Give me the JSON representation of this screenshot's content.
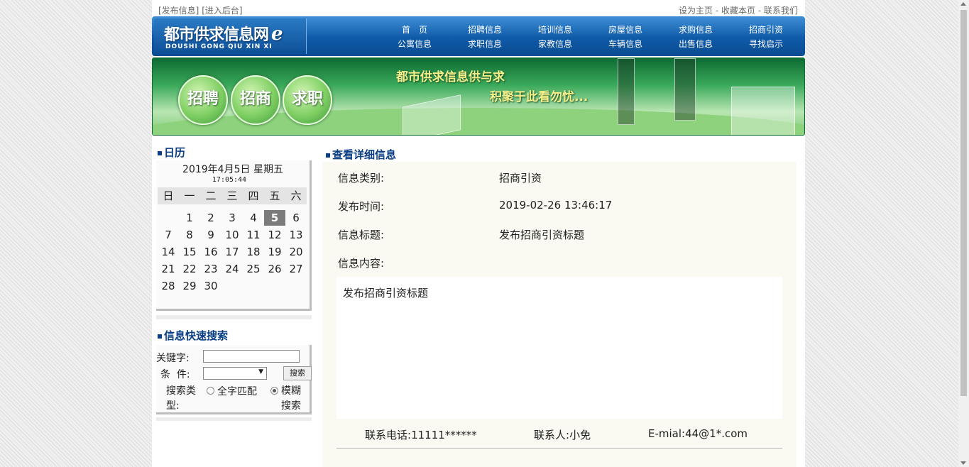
{
  "topbar": {
    "left_links": [
      "[发布信息]",
      "[进入后台]"
    ],
    "right_links": [
      "设为主页",
      "收藏本页",
      "联系我们"
    ],
    "separator": " - "
  },
  "header": {
    "logo_cn": "都市供求信息网",
    "logo_mark": "e",
    "logo_en": "DOUSHI GONG QIU XIN XI",
    "nav_row1": [
      "首　页",
      "招聘信息",
      "培训信息",
      "房屋信息",
      "求购信息",
      "招商引资"
    ],
    "nav_row2": [
      "公寓信息",
      "求职信息",
      "家教信息",
      "车辆信息",
      "出售信息",
      "寻找启示"
    ],
    "colors": {
      "header_blue": "#0f5aa8"
    }
  },
  "banner": {
    "buttons": [
      "招聘",
      "招商",
      "求职"
    ],
    "slogan1": "都市供求信息供与求",
    "slogan2": "积聚于此看勿忧..."
  },
  "calendar": {
    "title": "日历",
    "date_text": "2019年4月5日 星期五",
    "time_text": "17:05:44",
    "weekdays": [
      "日",
      "一",
      "二",
      "三",
      "四",
      "五",
      "六"
    ],
    "first_weekday": 1,
    "days_in_month": 30,
    "today": 5
  },
  "search": {
    "title": "信息快速搜索",
    "keyword_label": "关键字:",
    "keyword_value": "",
    "condition_label": "条  件:",
    "condition_value": "",
    "button_label": "搜索",
    "type_label": "搜索类型:",
    "options": [
      "全字匹配",
      "模糊搜索"
    ],
    "selected_option": 1
  },
  "detail": {
    "title": "查看详细信息",
    "rows": [
      {
        "label": "信息类别:",
        "value": "招商引资"
      },
      {
        "label": "发布时间:",
        "value": "2019-02-26 13:46:17"
      },
      {
        "label": "信息标题:",
        "value": "发布招商引资标题"
      },
      {
        "label": "信息内容:",
        "value": ""
      }
    ],
    "content": "发布招商引资标题",
    "contact": {
      "phone_label": "联系电话:",
      "phone": "11111******",
      "person_label": "联系人:",
      "person": "小免",
      "email_label": "E-mial:",
      "email": "44@1*.com"
    }
  }
}
